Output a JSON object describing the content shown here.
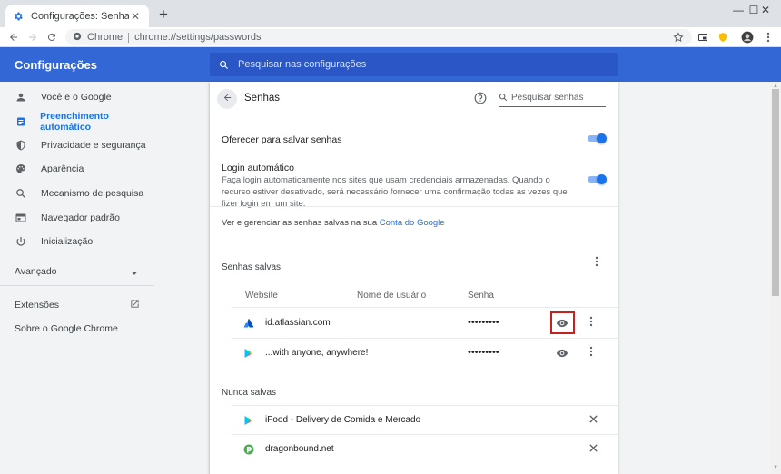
{
  "browser": {
    "tab_title": "Configurações: Senhas",
    "tab_close": "✕",
    "new_tab": "+",
    "site_chip": "Chrome",
    "url": "chrome://settings/passwords",
    "window_controls": {
      "minimize": "—",
      "maximize": "☐",
      "close": "✕"
    }
  },
  "header": {
    "title": "Configurações",
    "search_placeholder": "Pesquisar nas configurações",
    "color": "#3367d6"
  },
  "sidebar": {
    "items": [
      {
        "label": "Você e o Google",
        "icon": "person-icon"
      },
      {
        "label": "Preenchimento automático",
        "icon": "clipboard-icon",
        "active": true
      },
      {
        "label": "Privacidade e segurança",
        "icon": "shield-icon"
      },
      {
        "label": "Aparência",
        "icon": "palette-icon"
      },
      {
        "label": "Mecanismo de pesquisa",
        "icon": "search-icon"
      },
      {
        "label": "Navegador padrão",
        "icon": "browser-window-icon"
      },
      {
        "label": "Inicialização",
        "icon": "power-icon"
      }
    ],
    "advanced": "Avançado",
    "extensions": "Extensões",
    "about": "Sobre o Google Chrome"
  },
  "passwords_page": {
    "title": "Senhas",
    "search_placeholder": "Pesquisar senhas",
    "offer_to_save": {
      "label": "Oferecer para salvar senhas",
      "enabled": true
    },
    "auto_signin": {
      "label": "Login automático",
      "description": "Faça login automaticamente nos sites que usam credenciais armazenadas. Quando o recurso estiver desativado, será necessário fornecer uma confirmação todas as vezes que fizer login em um site.",
      "enabled": true
    },
    "manage_text": "Ver e gerenciar as senhas salvas na sua ",
    "manage_link": "Conta do Google",
    "saved_title": "Senhas salvas",
    "columns": {
      "website": "Website",
      "username": "Nome de usuário",
      "password": "Senha"
    },
    "saved": [
      {
        "site": "id.atlassian.com",
        "username": "",
        "password": "•••••••••",
        "icon": "atlassian-icon"
      },
      {
        "site": "...with anyone, anywhere!",
        "username": "",
        "password": "•••••••••",
        "icon": "play-store-icon"
      }
    ],
    "never_title": "Nunca salvas",
    "never": [
      {
        "site": "iFood - Delivery de Comida e Mercado",
        "icon": "play-store-icon"
      },
      {
        "site": "dragonbound.net",
        "icon": "dragonbound-icon"
      }
    ]
  },
  "colors": {
    "accent": "#1a73e8",
    "highlight": "#c5221f"
  }
}
